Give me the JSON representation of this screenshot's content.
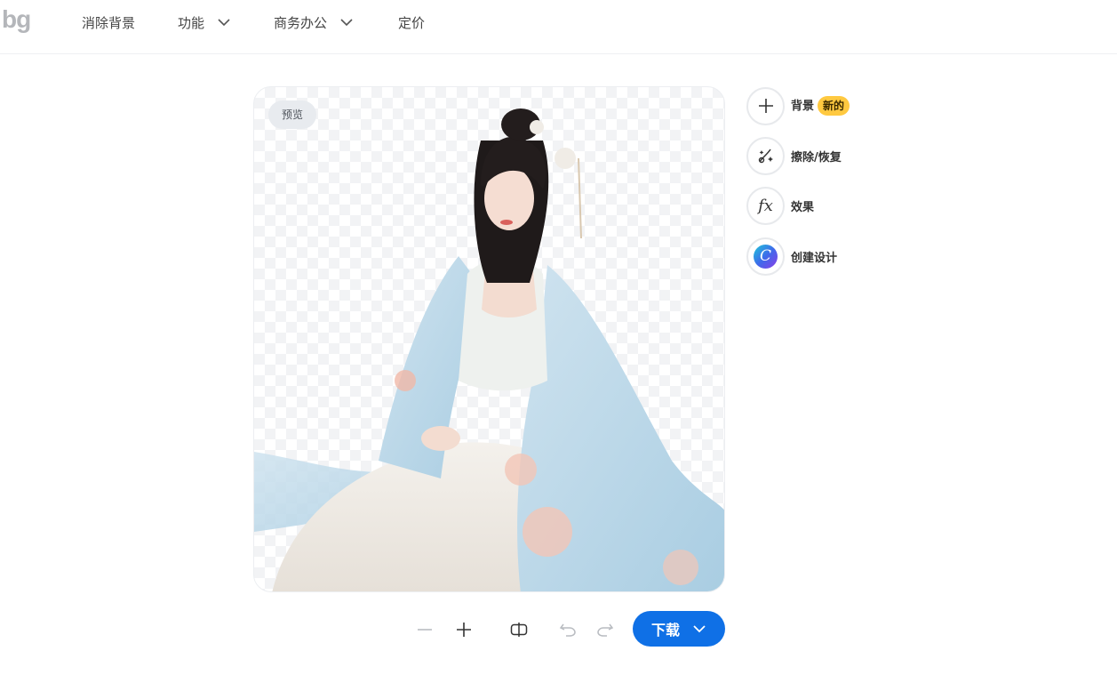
{
  "header": {
    "logo": "bg",
    "nav": [
      {
        "label": "消除背景",
        "has_dropdown": false
      },
      {
        "label": "功能",
        "has_dropdown": true
      },
      {
        "label": "商务办公",
        "has_dropdown": true
      },
      {
        "label": "定价",
        "has_dropdown": false
      }
    ]
  },
  "preview": {
    "badge": "预览"
  },
  "tools": [
    {
      "icon": "plus-icon",
      "label": "背景",
      "badge": "新的"
    },
    {
      "icon": "magic-brush-icon",
      "label": "擦除/恢复"
    },
    {
      "icon": "fx-icon",
      "label": "效果",
      "glyph": "fx"
    },
    {
      "icon": "canva-logo-icon",
      "label": "创建设计",
      "glyph": "C"
    }
  ],
  "toolbar": {
    "zoom_out_icon": "minus-icon",
    "zoom_in_icon": "plus-icon",
    "compare_icon": "compare-icon",
    "undo_icon": "undo-icon",
    "redo_icon": "redo-icon",
    "download_label": "下载"
  },
  "colors": {
    "accent": "#0f70e6",
    "badge_new": "#ffc940"
  }
}
